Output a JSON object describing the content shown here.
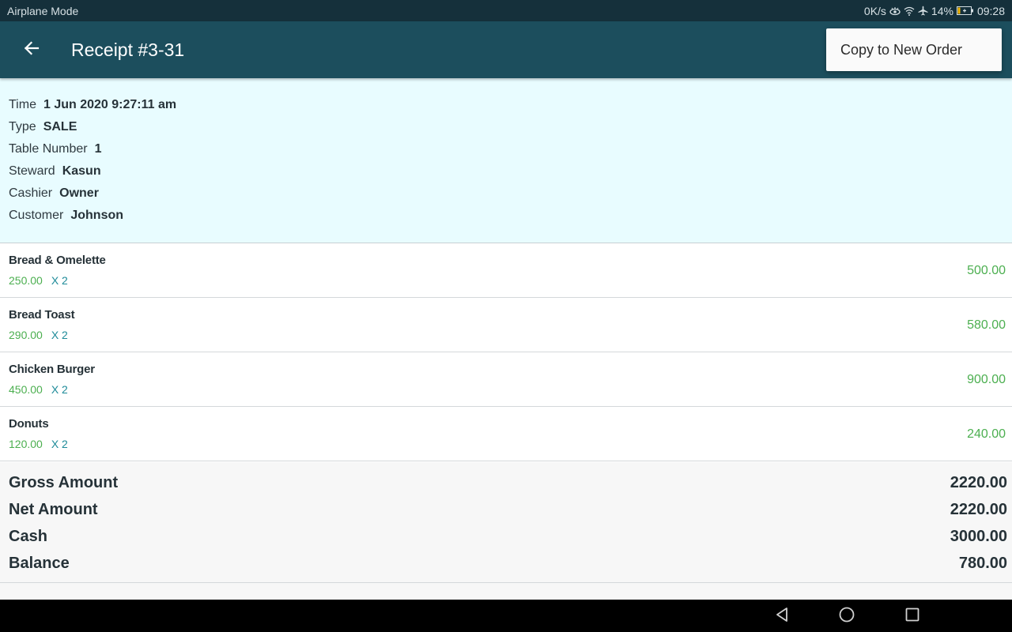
{
  "status_bar": {
    "left_text": "Airplane Mode",
    "network_speed": "0K/s",
    "battery_percent": "14%",
    "time": "09:28",
    "icons": [
      "eye-comfort-icon",
      "wifi-icon",
      "airplane-icon",
      "battery-charging-icon"
    ]
  },
  "app_bar": {
    "back_icon": "arrow-left-icon",
    "title": "Receipt #3-31"
  },
  "overflow_menu": {
    "items": [
      {
        "label": "Copy to New Order"
      }
    ]
  },
  "receipt_info": [
    {
      "label": "Time",
      "value": "1 Jun 2020 9:27:11 am"
    },
    {
      "label": "Type",
      "value": "SALE"
    },
    {
      "label": "Table Number",
      "value": "1"
    },
    {
      "label": "Steward",
      "value": "Kasun"
    },
    {
      "label": "Cashier",
      "value": "Owner"
    },
    {
      "label": "Customer",
      "value": "Johnson"
    }
  ],
  "line_items": [
    {
      "name": "Bread & Omelette",
      "unit_price": "250.00",
      "quantity": "X 2",
      "total": "500.00"
    },
    {
      "name": "Bread Toast",
      "unit_price": "290.00",
      "quantity": "X 2",
      "total": "580.00"
    },
    {
      "name": "Chicken Burger",
      "unit_price": "450.00",
      "quantity": "X 2",
      "total": "900.00"
    },
    {
      "name": "Donuts",
      "unit_price": "120.00",
      "quantity": "X 2",
      "total": "240.00"
    }
  ],
  "totals": [
    {
      "label": "Gross Amount",
      "value": "2220.00"
    },
    {
      "label": "Net Amount",
      "value": "2220.00"
    },
    {
      "label": "Cash",
      "value": "3000.00"
    },
    {
      "label": "Balance",
      "value": "780.00"
    }
  ],
  "nav_bar": {
    "buttons": [
      "back-triangle-icon",
      "home-circle-icon",
      "recents-square-icon"
    ]
  },
  "colors": {
    "status_bar": "#15303b",
    "app_bar": "#1c4e5d",
    "info_background": "#e8fcff",
    "price_green": "#4caf50",
    "quantity_teal": "#1e8b99",
    "text_dark": "#263238"
  }
}
